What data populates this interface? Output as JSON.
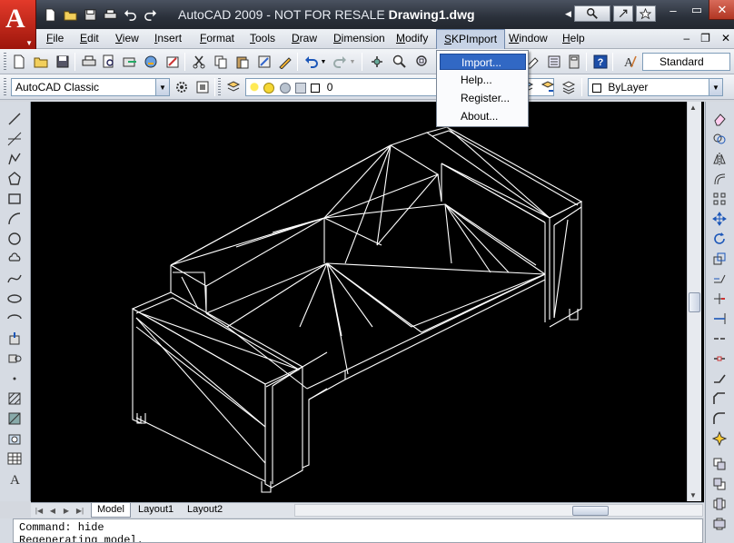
{
  "window": {
    "app_title": "AutoCAD 2009 - NOT FOR RESALE",
    "doc_title": "Drawing1.dwg",
    "app_logo": "A"
  },
  "menubar": {
    "items": [
      {
        "label": "File",
        "key": "F",
        "rest": "ile"
      },
      {
        "label": "Edit",
        "key": "E",
        "rest": "dit"
      },
      {
        "label": "View",
        "key": "V",
        "rest": "iew"
      },
      {
        "label": "Insert",
        "key": "I",
        "rest": "nsert"
      },
      {
        "label": "Format",
        "key": "F",
        "rest": "ormat"
      },
      {
        "label": "Tools",
        "key": "T",
        "rest": "ools"
      },
      {
        "label": "Draw",
        "key": "D",
        "rest": "raw"
      },
      {
        "label": "Dimension",
        "key": "D",
        "rest": "imension"
      },
      {
        "label": "Modify",
        "key": "M",
        "rest": "odify"
      },
      {
        "label": "SKPImport",
        "key": "S",
        "rest": "KPImport"
      },
      {
        "label": "Window",
        "key": "W",
        "rest": "indow"
      },
      {
        "label": "Help",
        "key": "H",
        "rest": "elp"
      }
    ],
    "open_menu": "SKPImport"
  },
  "dropdown": {
    "items": [
      "Import...",
      "Help...",
      "Register...",
      "About..."
    ],
    "highlighted": "Import..."
  },
  "toolbar": {
    "text_style": "Standard",
    "workspace": "AutoCAD Classic",
    "layer": "0",
    "color": "ByLayer"
  },
  "tabs": {
    "items": [
      "Model",
      "Layout1",
      "Layout2"
    ],
    "active": "Model"
  },
  "command_line": {
    "lines": [
      "Command: hide",
      "Regenerating model."
    ]
  },
  "colors": {
    "title_bar": "#2a303a",
    "drawing_bg": "#000000",
    "wire": "#ffffff",
    "menu_highlight": "#3168c4"
  }
}
